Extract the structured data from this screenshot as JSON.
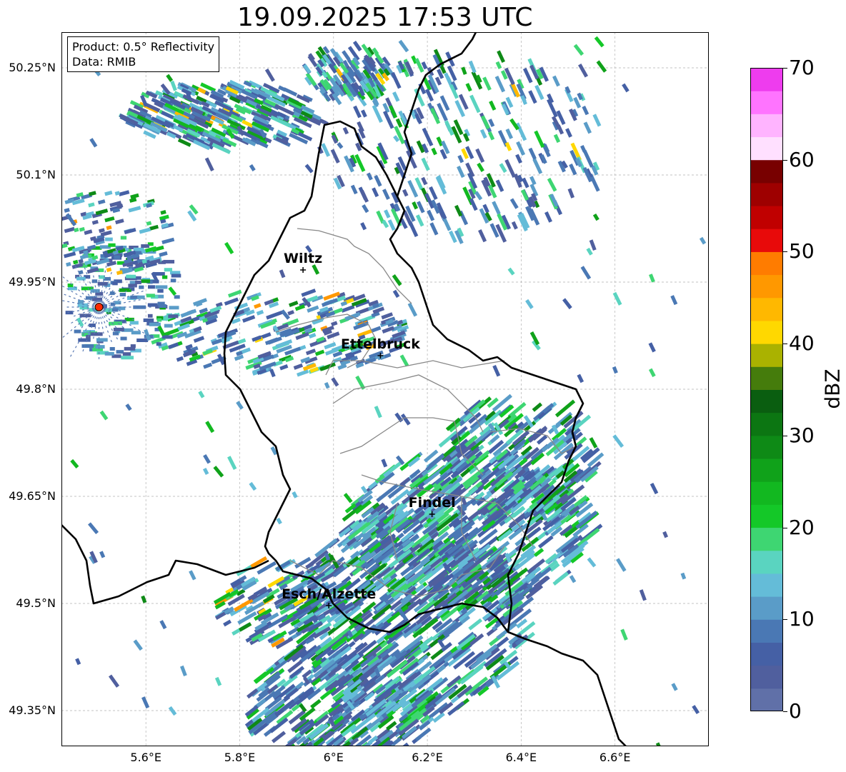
{
  "title": "19.09.2025 17:53 UTC",
  "info": {
    "product": "Product: 0.5° Reflectivity",
    "data": "Data: RMIB"
  },
  "map": {
    "lon_range": [
      5.42,
      6.8
    ],
    "lat_range": [
      49.3,
      50.3
    ],
    "lat_ticks": [
      {
        "value": 50.25,
        "label": "50.25°N"
      },
      {
        "value": 50.1,
        "label": "50.1°N"
      },
      {
        "value": 49.95,
        "label": "49.95°N"
      },
      {
        "value": 49.8,
        "label": "49.8°N"
      },
      {
        "value": 49.65,
        "label": "49.65°N"
      },
      {
        "value": 49.5,
        "label": "49.5°N"
      },
      {
        "value": 49.35,
        "label": "49.35°N"
      }
    ],
    "lon_ticks": [
      {
        "value": 5.6,
        "label": "5.6°E"
      },
      {
        "value": 5.8,
        "label": "5.8°E"
      },
      {
        "value": 6.0,
        "label": "6°E"
      },
      {
        "value": 6.2,
        "label": "6.2°E"
      },
      {
        "value": 6.4,
        "label": "6.4°E"
      },
      {
        "value": 6.6,
        "label": "6.6°E"
      }
    ],
    "cities": [
      {
        "name": "Wiltz",
        "lon": 5.935,
        "lat": 49.967
      },
      {
        "name": "Ettelbruck",
        "lon": 6.1,
        "lat": 49.847
      },
      {
        "name": "Findel",
        "lon": 6.21,
        "lat": 49.625
      },
      {
        "name": "Esch/Alzette",
        "lon": 5.99,
        "lat": 49.497
      }
    ],
    "radar_site": {
      "lon": 5.5,
      "lat": 49.915,
      "color": "#ff2a00"
    },
    "border_color": "#000000",
    "canton_color": "#888888",
    "grid_color": "#b0b0b0"
  },
  "colorbar": {
    "label": "dBZ",
    "min": 0,
    "max": 70,
    "ticks": [
      "0",
      "10",
      "20",
      "30",
      "40",
      "50",
      "60",
      "70"
    ],
    "colors": [
      "#6070a8",
      "#505f9e",
      "#4560a5",
      "#4a78b4",
      "#5a9cc8",
      "#64bcd8",
      "#5ad4c0",
      "#3ed672",
      "#14c828",
      "#12b820",
      "#10a21a",
      "#0e8a16",
      "#0c7612",
      "#0a5e10",
      "#457c0c",
      "#aab200",
      "#ffd800",
      "#ffb800",
      "#ff9800",
      "#ff7c00",
      "#e80a0a",
      "#c00000",
      "#9e0000",
      "#780000",
      "#ffe0ff",
      "#ffb4ff",
      "#ff74ff",
      "#ee3cee"
    ]
  }
}
